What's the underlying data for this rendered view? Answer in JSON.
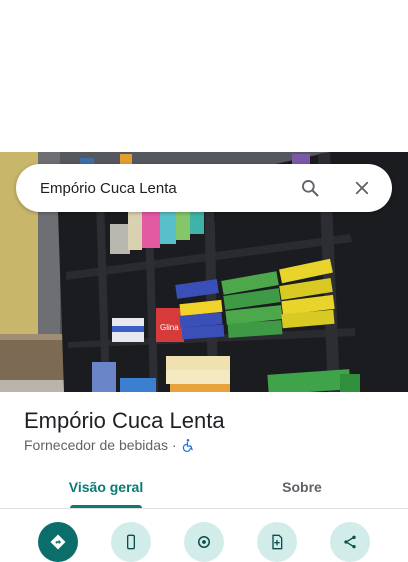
{
  "search": {
    "query": "Empório Cuca Lenta"
  },
  "place": {
    "name": "Empório Cuca Lenta",
    "category": "Fornecedor de bebidas",
    "separator": "·"
  },
  "tabs": [
    {
      "label": "Visão geral",
      "selected": true
    },
    {
      "label": "Sobre",
      "selected": false
    }
  ],
  "actions": [
    {
      "icon": "directions-icon"
    },
    {
      "icon": "phone-icon"
    },
    {
      "icon": "location-icon"
    },
    {
      "icon": "save-icon"
    },
    {
      "icon": "share-icon"
    }
  ],
  "colors": {
    "accent": "#0b7a75",
    "primary_button": "#0b6e6a",
    "secondary_button": "#d2ecea",
    "text_secondary": "#5f6368",
    "wheelchair": "#1a73e8"
  },
  "photo": {
    "product_label": "Glina"
  }
}
